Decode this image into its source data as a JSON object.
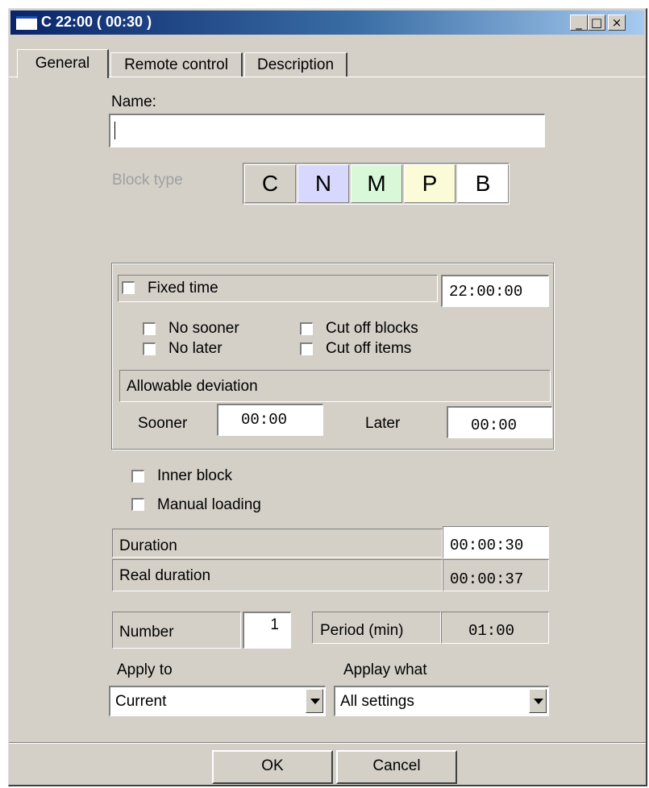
{
  "window": {
    "title": "C 22:00 ( 00:30 )",
    "minimize": "_",
    "maximize": "□",
    "close": "×"
  },
  "tabs": [
    {
      "label": "General"
    },
    {
      "label": "Remote control"
    },
    {
      "label": "Description"
    }
  ],
  "name": {
    "label": "Name:",
    "value": ""
  },
  "block_type": {
    "label": "Block type",
    "options": [
      {
        "letter": "C",
        "color": "#d4d0c8"
      },
      {
        "letter": "N",
        "color": "#d8d8ff"
      },
      {
        "letter": "M",
        "color": "#d8f8d8"
      },
      {
        "letter": "P",
        "color": "#fbfbd8"
      },
      {
        "letter": "B",
        "color": "#ffffff"
      }
    ]
  },
  "fixed_time": {
    "label": "Fixed time",
    "checked": false,
    "time": "22:00:00",
    "no_sooner": "No sooner",
    "no_later": "No later",
    "cut_off_blocks": "Cut off blocks",
    "cut_off_items": "Cut off items",
    "deviation_header": "Allowable deviation",
    "sooner_label": "Sooner",
    "sooner_value": "00:00",
    "later_label": "Later",
    "later_value": "00:00"
  },
  "options": {
    "inner_block": "Inner block",
    "manual_loading": "Manual loading"
  },
  "durations": {
    "duration_label": "Duration",
    "duration_value": "00:00:30",
    "real_label": "Real duration",
    "real_value": "00:00:37"
  },
  "repeat": {
    "number_label": "Number",
    "number_value": "1",
    "period_label": "Period (min)",
    "period_value": "01:00"
  },
  "apply": {
    "apply_to_label": "Apply to",
    "apply_to_value": "Current",
    "apply_what_label": "Applay what",
    "apply_what_value": "All settings"
  },
  "buttons": {
    "ok": "OK",
    "cancel": "Cancel"
  }
}
